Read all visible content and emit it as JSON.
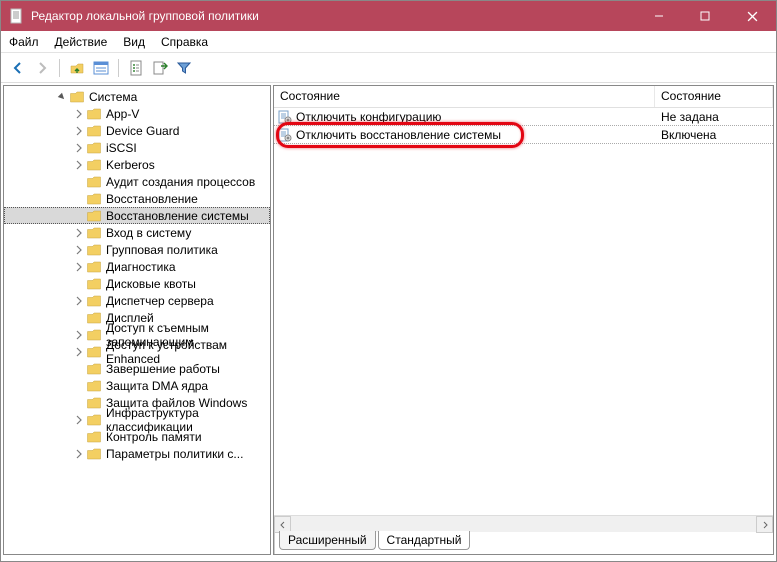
{
  "window": {
    "title": "Редактор локальной групповой политики"
  },
  "menu": {
    "file": "Файл",
    "action": "Действие",
    "view": "Вид",
    "help": "Справка"
  },
  "toolbar": {
    "back": "back",
    "forward": "forward",
    "up": "up",
    "props": "properties",
    "refresh": "refresh",
    "export": "export",
    "help": "help",
    "filter": "filter"
  },
  "tree": {
    "root": "Система",
    "items": [
      "App-V",
      "Device Guard",
      "iSCSI",
      "Kerberos",
      "Аудит создания процессов",
      "Восстановление",
      "Восстановление системы",
      "Вход в систему",
      "Групповая политика",
      "Диагностика",
      "Дисковые квоты",
      "Диспетчер сервера",
      "Дисплей",
      "Доступ к съемным запоминающим",
      "Доступ к устройствам Enhanced",
      "Завершение работы",
      "Защита DMA ядра",
      "Защита файлов Windows",
      "Инфраструктура классификации",
      "Контроль памяти",
      "Параметры политики с..."
    ],
    "selected_index": 6
  },
  "list": {
    "headers": {
      "c1": "Состояние",
      "c2": "Состояние"
    },
    "rows": [
      {
        "name": "Отключить конфигурацию",
        "state": "Не задана"
      },
      {
        "name": "Отключить восстановление системы",
        "state": "Включена"
      }
    ],
    "highlighted_index": 1
  },
  "tabs": {
    "extended": "Расширенный",
    "standard": "Стандартный"
  }
}
